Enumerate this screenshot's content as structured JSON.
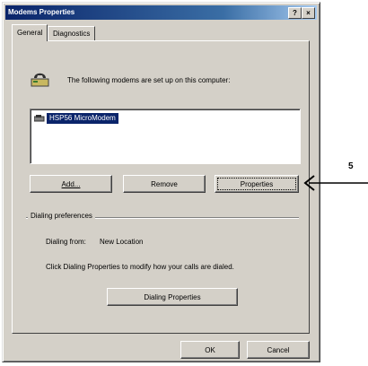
{
  "window": {
    "title": "Modems Properties",
    "help_button": "?",
    "close_button": "×"
  },
  "tabs": [
    "General",
    "Diagnostics"
  ],
  "general": {
    "intro_text": "The following modems are set up on this computer:",
    "modems": [
      "HSP56 MicroModem"
    ],
    "buttons": {
      "add": "Add...",
      "remove": "Remove",
      "properties": "Properties"
    },
    "dialing_group_label": "Dialing preferences",
    "dialing_from_label": "Dialing from:",
    "dialing_from_value": "New Location",
    "dialing_hint": "Click Dialing Properties to modify how your calls are dialed.",
    "dialing_properties_button": "Dialing Properties"
  },
  "footer": {
    "ok": "OK",
    "cancel": "Cancel"
  },
  "callout": {
    "number": "5"
  }
}
